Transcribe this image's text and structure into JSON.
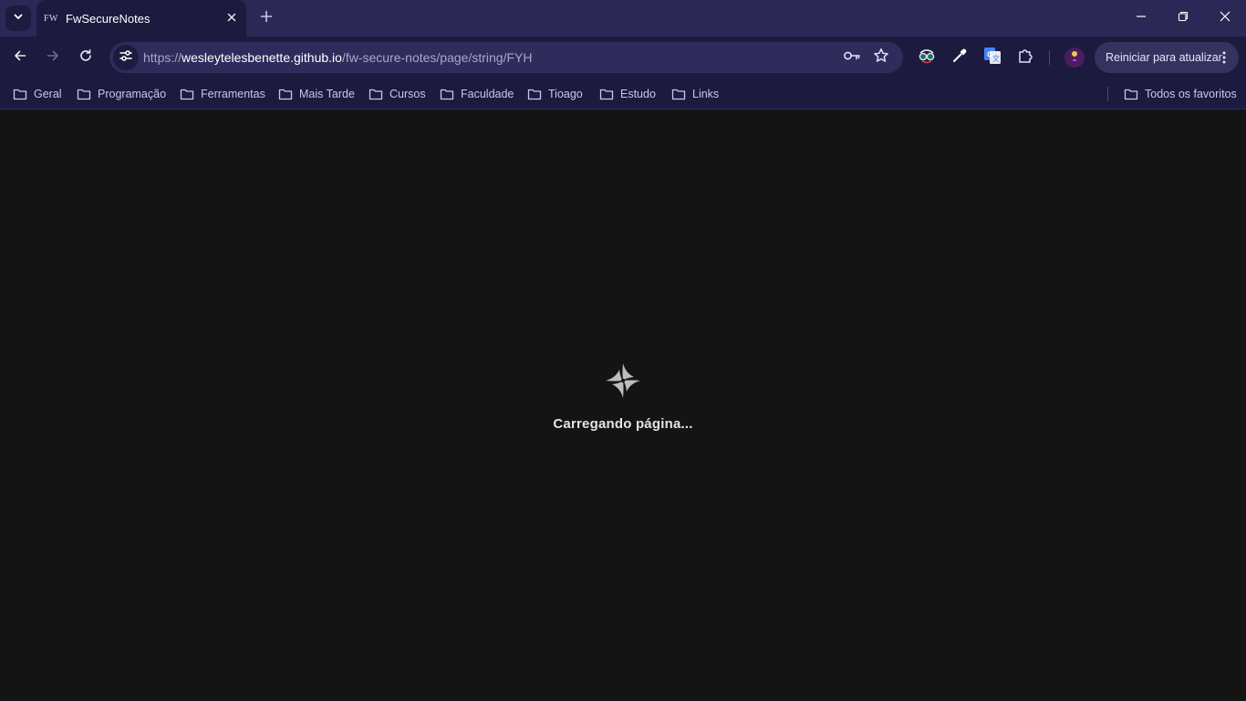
{
  "browser": {
    "tab": {
      "favicon_text": "FW",
      "title": "FwSecureNotes"
    },
    "address": {
      "scheme": "https://",
      "host": "wesleytelesbenette.github.io",
      "path": "/fw-secure-notes/page/string/FYH"
    },
    "update_button_label": "Reiniciar para atualizar",
    "icons": {
      "tab_search": "chevron-down-icon",
      "tab_close": "close-icon",
      "new_tab": "plus-icon",
      "minimize": "minimize-icon",
      "restore": "restore-icon",
      "close": "close-icon",
      "back": "arrow-left-icon",
      "forward": "arrow-right-icon",
      "reload": "reload-icon",
      "site_info": "tune-icon",
      "password": "key-icon",
      "bookmark": "star-icon",
      "extensions": "puzzle-icon",
      "menu": "kebab-icon"
    }
  },
  "bookmarks": {
    "items": [
      {
        "label": "Geral"
      },
      {
        "label": "Programação"
      },
      {
        "label": "Ferramentas"
      },
      {
        "label": "Mais Tarde"
      },
      {
        "label": "Cursos"
      },
      {
        "label": "Faculdade"
      },
      {
        "label": "Tioago"
      },
      {
        "label": "Estudo"
      },
      {
        "label": "Links"
      }
    ],
    "all_bookmarks": "Todos os favoritos"
  },
  "page": {
    "loading_text": "Carregando página..."
  },
  "colors": {
    "frame": "#2b2856",
    "toolbar": "#1c1a3e",
    "omnibox": "#2f2c5c",
    "page_background": "#141414",
    "bookmark_text": "#c9c6f2"
  }
}
